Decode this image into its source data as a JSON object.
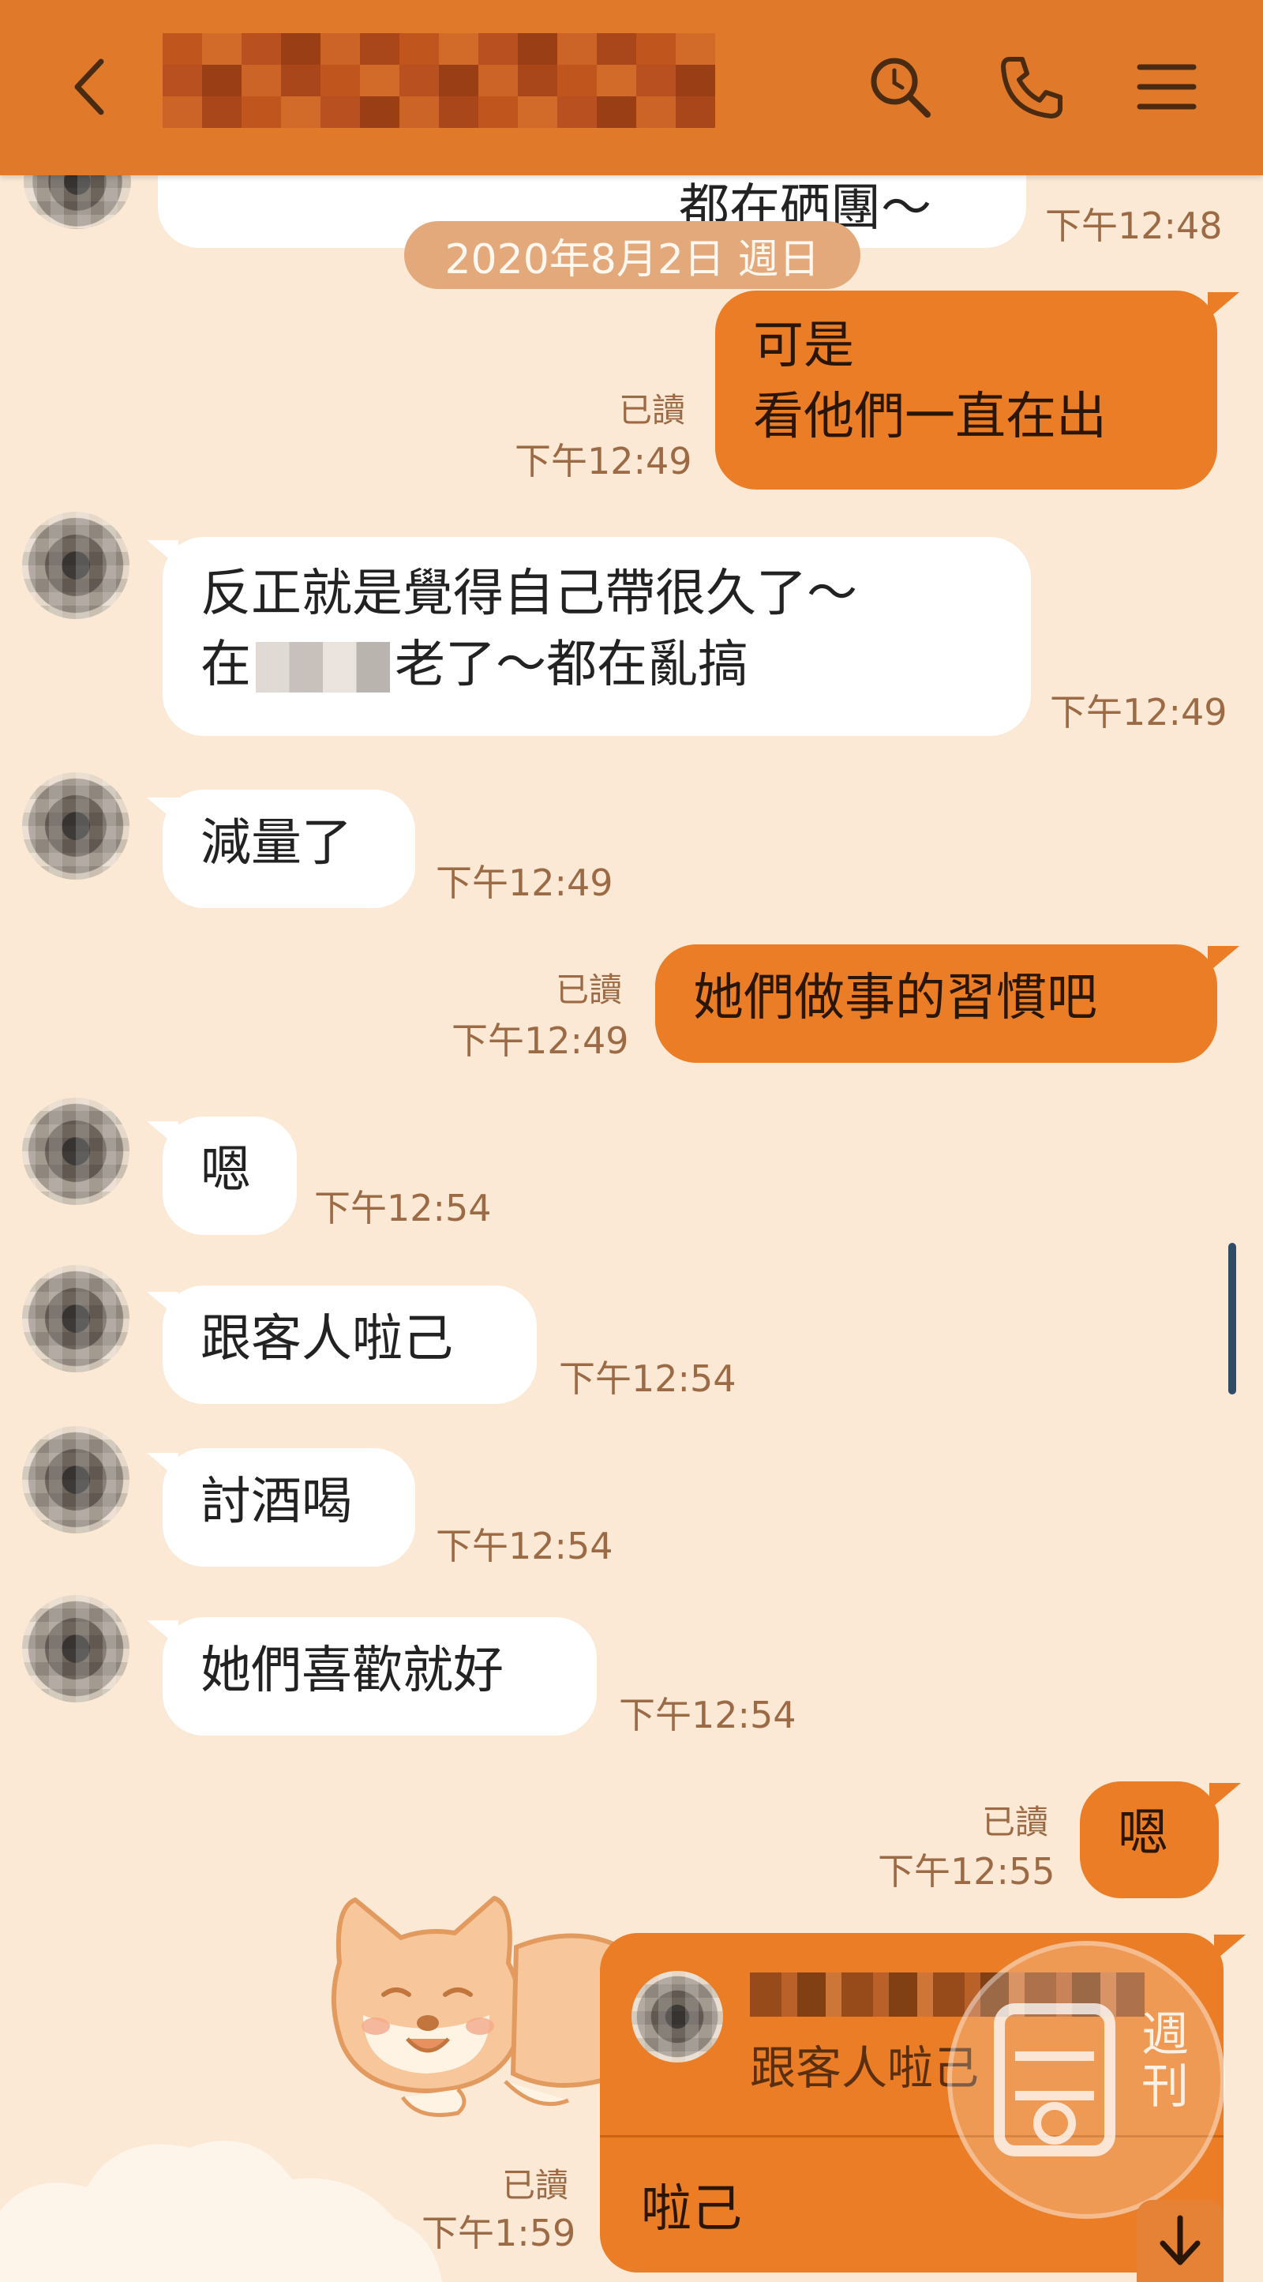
{
  "header": {
    "title_label": "",
    "back_icon": "chevron-left-icon",
    "search_icon": "search-icon",
    "call_icon": "phone-icon",
    "menu_icon": "menu-icon"
  },
  "colors": {
    "header": "#e07a2a",
    "background": "#fbe9d6",
    "outgoing": "#ea7d25",
    "incoming": "#ffffff",
    "meta": "#9c6b45"
  },
  "date_separator": "2020年8月2日 週日",
  "top_partial": {
    "text": "都在硒團～",
    "time": "下午12:48"
  },
  "messages": [
    {
      "dir": "out",
      "lines": [
        "可是",
        "看他們一直在出"
      ],
      "read": "已讀",
      "time": "下午12:49"
    },
    {
      "dir": "in",
      "lines": [
        "反正就是覺得自己帶很久了～",
        "在",
        "老了～都在亂搞"
      ],
      "time": "下午12:49"
    },
    {
      "dir": "in",
      "lines": [
        "減量了"
      ],
      "time": "下午12:49"
    },
    {
      "dir": "out",
      "lines": [
        "她們做事的習慣吧"
      ],
      "read": "已讀",
      "time": "下午12:49"
    },
    {
      "dir": "in",
      "lines": [
        "嗯"
      ],
      "time": "下午12:54"
    },
    {
      "dir": "in",
      "lines": [
        "跟客人啦己"
      ],
      "time": "下午12:54"
    },
    {
      "dir": "in",
      "lines": [
        "討酒喝"
      ],
      "time": "下午12:54"
    },
    {
      "dir": "in",
      "lines": [
        "她們喜歡就好"
      ],
      "time": "下午12:54"
    },
    {
      "dir": "out",
      "lines": [
        "嗯"
      ],
      "read": "已讀",
      "time": "下午12:55"
    }
  ],
  "reply": {
    "quoted_text": "跟客人啦己",
    "text": "啦己",
    "read": "已讀",
    "time": "下午1:59"
  },
  "scroll_down_icon": "arrow-down-icon",
  "watermark": {
    "chars": [
      "週",
      "刊"
    ]
  }
}
